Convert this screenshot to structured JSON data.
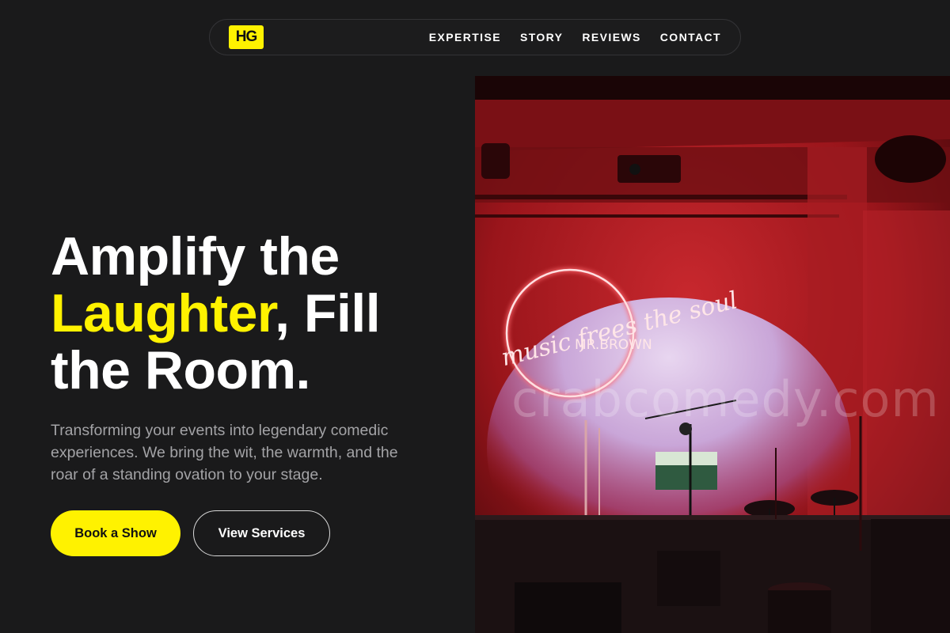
{
  "nav": {
    "logo": "HG",
    "links": [
      "EXPERTISE",
      "STORY",
      "REVIEWS",
      "CONTACT"
    ]
  },
  "hero": {
    "title_part1": "Amplify the",
    "title_highlight": "Laughter",
    "title_part2": ", Fill the Room.",
    "subtitle": "Transforming your events into legendary comedic experiences. We bring the wit, the warmth, and the roar of a standing ovation to your stage.",
    "primary_button": "Book a Show",
    "secondary_button": "View Services"
  },
  "image": {
    "neon_text_line1": "music frees the soul",
    "neon_text_line2": "MR.BROWN",
    "watermark": "crabcomedy.com"
  },
  "colors": {
    "accent": "#fff200",
    "background": "#1a1a1b",
    "muted_text": "#a3a3a6"
  }
}
